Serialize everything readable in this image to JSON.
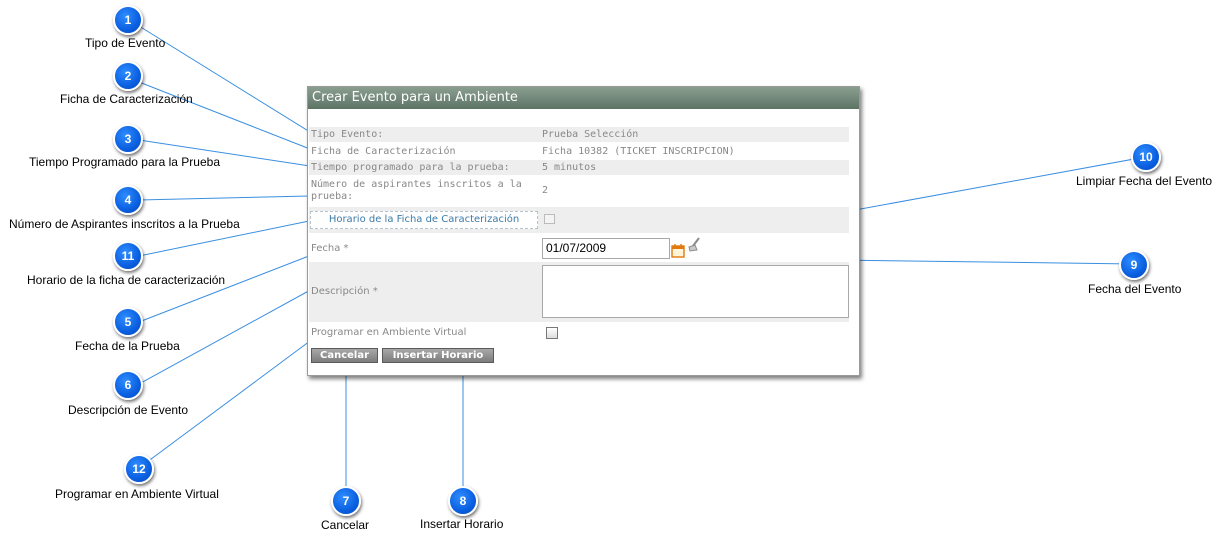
{
  "dialog": {
    "title": "Crear Evento para un Ambiente",
    "rows": [
      {
        "label": "Tipo Evento:",
        "value": "Prueba Selección"
      },
      {
        "label": "Ficha de Caracterización",
        "value": "Ficha 10382 (TICKET INSCRIPCION)"
      },
      {
        "label": "Tiempo programado para la prueba:",
        "value": "5 minutos"
      },
      {
        "label_line1": "Número de aspirantes inscritos a la",
        "label_line2": "prueba:",
        "value": "2"
      }
    ],
    "schedule_link": "Horario de la Ficha de Caracterización",
    "fecha_label": "Fecha *",
    "fecha_value": "01/07/2009",
    "descripcion_label": "Descripción *",
    "virtual_label": "Programar en Ambiente Virtual",
    "cancel_label": "Cancelar",
    "insert_label": "Insertar Horario"
  },
  "callouts": [
    {
      "number": "1",
      "text": "Tipo de Evento"
    },
    {
      "number": "2",
      "text": "Ficha de Caracterización"
    },
    {
      "number": "3",
      "text": "Tiempo Programado para la Prueba"
    },
    {
      "number": "4",
      "text": "Número de Aspirantes inscritos a la Prueba"
    },
    {
      "number": "11",
      "text": "Horario de la ficha de caracterización"
    },
    {
      "number": "5",
      "text": "Fecha de la Prueba"
    },
    {
      "number": "6",
      "text": "Descripción de Evento"
    },
    {
      "number": "12",
      "text": "Programar en Ambiente Virtual"
    },
    {
      "number": "7",
      "text": "Cancelar"
    },
    {
      "number": "8",
      "text": "Insertar Horario"
    },
    {
      "number": "9",
      "text": "Fecha del Evento"
    },
    {
      "number": "10",
      "text": "Limpiar Fecha del Evento"
    }
  ],
  "colors": {
    "badge": "#0a5fe0",
    "line": "#3a8fe0",
    "title_bar": "#6b8274"
  }
}
